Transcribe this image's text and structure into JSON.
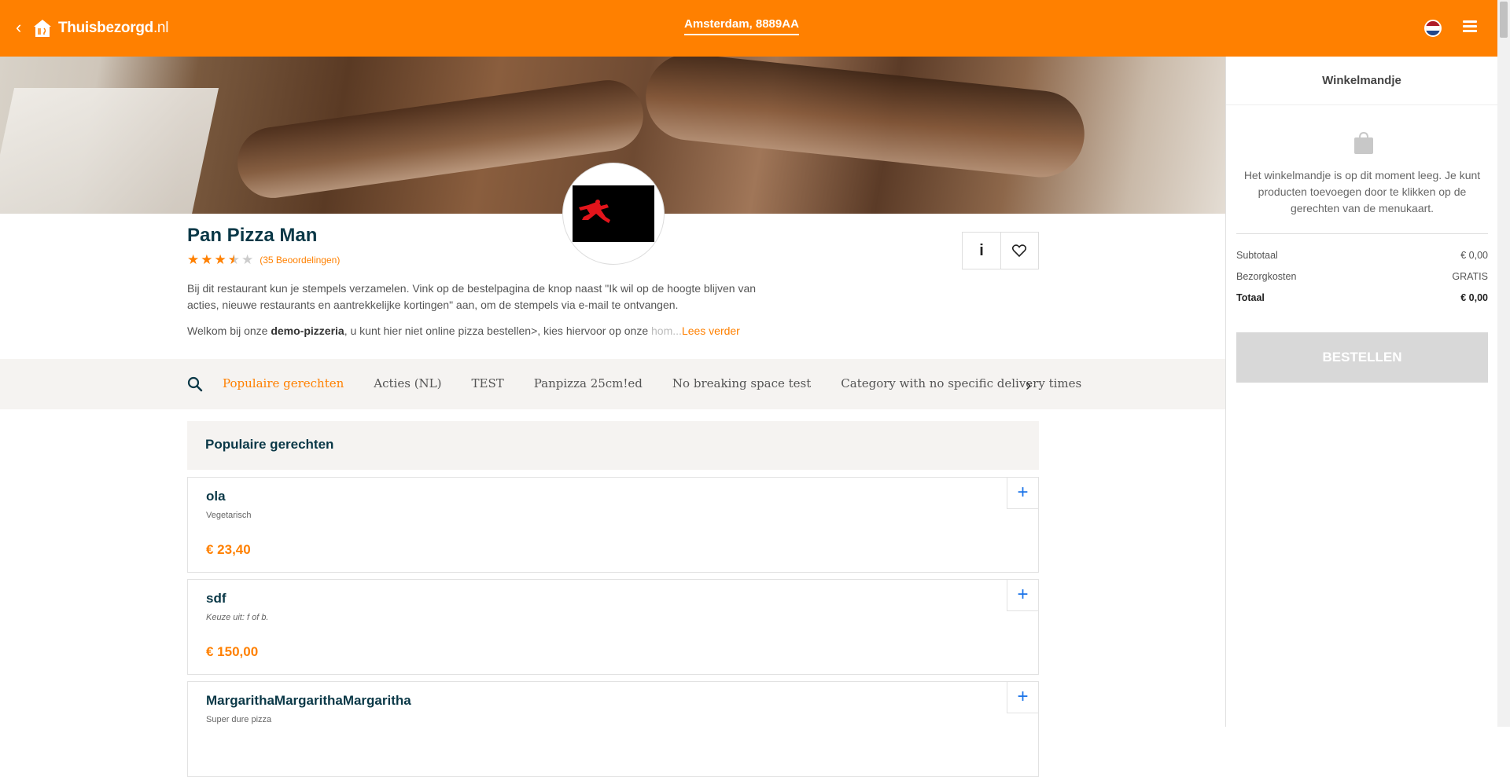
{
  "header": {
    "logo_text": "Thuisbezorgd",
    "logo_tld": ".nl",
    "location": "Amsterdam, 8889AA",
    "back_icon": "chevron-left-icon",
    "language_icon": "netherlands-flag-icon",
    "menu_icon": "hamburger-menu-icon",
    "accent_color": "#ff8000"
  },
  "restaurant": {
    "name": "Pan Pizza Man",
    "rating": 3.5,
    "rating_max": 5,
    "reviews_label": "(35 Beoordelingen)",
    "info_label": "i",
    "favorite_icon": "heart-icon",
    "notice": "Bij dit restaurant kun je stempels verzamelen. Vink op de bestelpagina de knop naast \"Ik wil op de hoogte blijven van acties, nieuwe restaurants en aantrekkelijke kortingen\" aan, om de stempels via e-mail te ontvangen.",
    "welcome_prefix": "Welkom bij onze ",
    "welcome_bold": "demo-pizzeria",
    "welcome_rest": ", u kunt hier niet online pizza bestellen>, kies hiervoor op onze ",
    "welcome_fade": "hom",
    "ellipsis": "...",
    "read_more": "Lees verder"
  },
  "categories": {
    "items": [
      "Populaire gerechten",
      "Acties (NL)",
      "TEST",
      "Panpizza 25cm!ed",
      "No breaking space test",
      "Category with no specific delivery times"
    ],
    "active_index": 0
  },
  "menu": {
    "section_title": "Populaire gerechten",
    "meals": [
      {
        "name": "ola",
        "description": "Vegetarisch",
        "price": "€ 23,40",
        "add": "+"
      },
      {
        "name": "sdf",
        "description": "Keuze uit: f of b.",
        "price": "€ 150,00",
        "add": "+"
      },
      {
        "name": "MargarithaMargarithaMargaritha",
        "description": "Super dure pizza",
        "price": "",
        "add": "+"
      }
    ]
  },
  "basket": {
    "title": "Winkelmandje",
    "empty_text": "Het winkelmandje is op dit moment leeg. Je kunt producten toevoegen door te klikken op de gerechten van de menukaart.",
    "subtotal_label": "Subtotaal",
    "subtotal_value": "€ 0,00",
    "delivery_label": "Bezorgkosten",
    "delivery_value": "GRATIS",
    "total_label": "Totaal",
    "total_value": "€ 0,00",
    "order_button": "BESTELLEN"
  }
}
